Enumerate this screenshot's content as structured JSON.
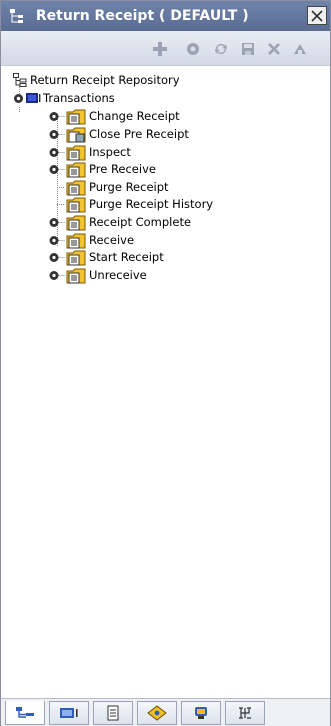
{
  "window": {
    "title": "Return Receipt ( DEFAULT )",
    "close_icon": "close-icon"
  },
  "toolbar": {
    "icons": [
      "add-icon",
      "details-icon",
      "refresh-icon",
      "save-icon",
      "delete-icon",
      "extra-icon"
    ]
  },
  "tree": {
    "root": "Return Receipt Repository",
    "group": "Transactions",
    "items": [
      {
        "label": "Change Receipt",
        "expandable": true
      },
      {
        "label": "Close Pre Receipt",
        "expandable": true
      },
      {
        "label": "Inspect",
        "expandable": true
      },
      {
        "label": "Pre Receive",
        "expandable": true
      },
      {
        "label": "Purge Receipt",
        "expandable": false
      },
      {
        "label": "Purge Receipt History",
        "expandable": false
      },
      {
        "label": "Receipt Complete",
        "expandable": true
      },
      {
        "label": "Receive",
        "expandable": true
      },
      {
        "label": "Start Receipt",
        "expandable": true
      },
      {
        "label": "Unreceive",
        "expandable": true
      }
    ]
  },
  "bottom_tabs": [
    "tree-tab-icon",
    "component-tab-icon",
    "document-tab-icon",
    "rules-tab-icon",
    "notes-tab-icon",
    "config-tab-icon"
  ]
}
